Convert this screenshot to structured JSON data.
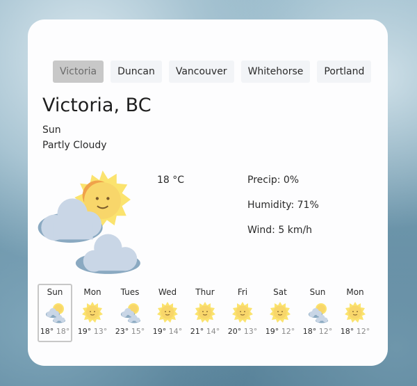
{
  "tabs": [
    {
      "label": "Victoria",
      "active": true
    },
    {
      "label": "Duncan",
      "active": false
    },
    {
      "label": "Vancouver",
      "active": false
    },
    {
      "label": "Whitehorse",
      "active": false
    },
    {
      "label": "Portland",
      "active": false
    }
  ],
  "current": {
    "city": "Victoria, BC",
    "day": "Sun",
    "condition": "Partly Cloudy",
    "icon": "partly-cloudy-icon",
    "temperature": "18 °C",
    "precip": "Precip: 0%",
    "humidity": "Humidity: 71%",
    "wind": "Wind: 5 km/h"
  },
  "forecast": [
    {
      "day": "Sun",
      "icon": "partly-cloudy-icon",
      "high": "18°",
      "low": "18°",
      "selected": true
    },
    {
      "day": "Mon",
      "icon": "sun-icon",
      "high": "19°",
      "low": "13°",
      "selected": false
    },
    {
      "day": "Tues",
      "icon": "partly-cloudy-icon",
      "high": "23°",
      "low": "15°",
      "selected": false
    },
    {
      "day": "Wed",
      "icon": "sun-icon",
      "high": "19°",
      "low": "14°",
      "selected": false
    },
    {
      "day": "Thur",
      "icon": "sun-icon",
      "high": "21°",
      "low": "14°",
      "selected": false
    },
    {
      "day": "Fri",
      "icon": "sun-icon",
      "high": "20°",
      "low": "13°",
      "selected": false
    },
    {
      "day": "Sat",
      "icon": "sun-icon",
      "high": "19°",
      "low": "12°",
      "selected": false
    },
    {
      "day": "Sun",
      "icon": "partly-cloudy-icon",
      "high": "18°",
      "low": "12°",
      "selected": false
    },
    {
      "day": "Mon",
      "icon": "sun-icon",
      "high": "18°",
      "low": "12°",
      "selected": false
    }
  ],
  "colors": {
    "sun": "#f8d66a",
    "sun_rays": "#fbe36e",
    "cloud": "#c9d6e6",
    "cloud_shade": "#8aa9c1",
    "active_tab": "#c8c8c8"
  }
}
